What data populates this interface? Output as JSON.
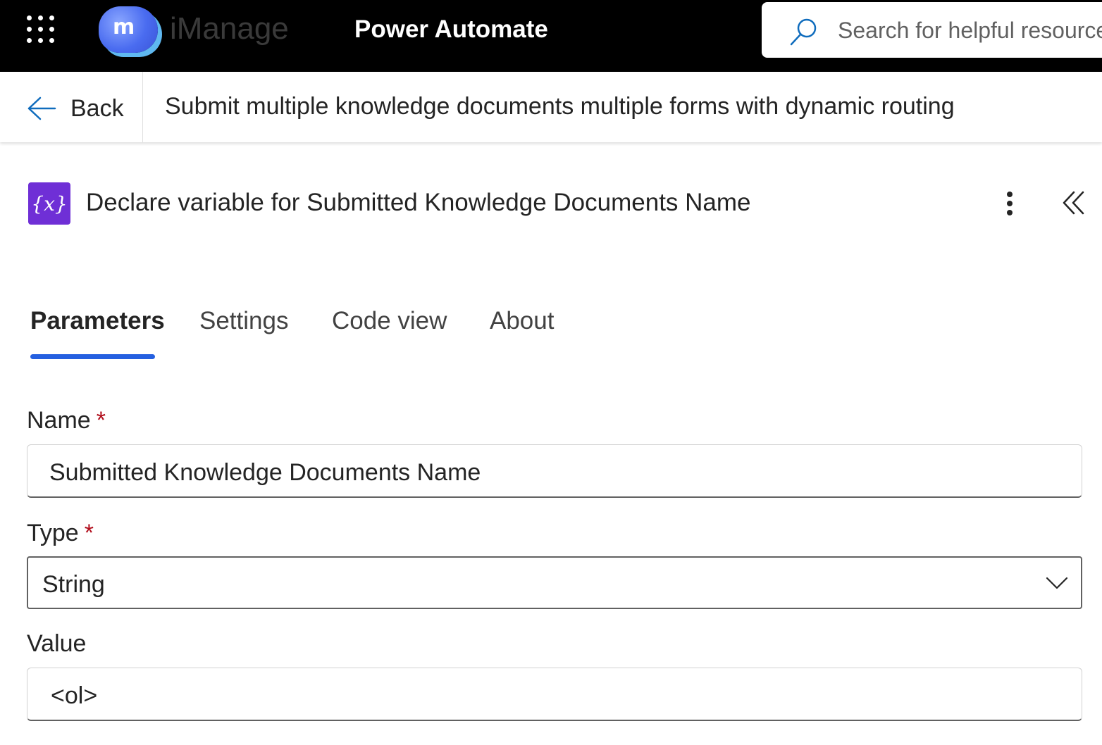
{
  "topbar": {
    "logo_mark": "m",
    "logo_text": "iManage",
    "app_title": "Power Automate",
    "search_placeholder": "Search for helpful resources"
  },
  "header": {
    "back_label": "Back",
    "flow_title": "Submit multiple knowledge documents multiple forms with dynamic routing"
  },
  "action": {
    "icon_text": "{x}",
    "title": "Declare variable for Submitted Knowledge Documents Name",
    "icon_color": "#6f2fd6"
  },
  "tabs": [
    {
      "label": "Parameters",
      "active": true
    },
    {
      "label": "Settings",
      "active": false
    },
    {
      "label": "Code view",
      "active": false
    },
    {
      "label": "About",
      "active": false
    }
  ],
  "form": {
    "name_label": "Name",
    "name_value": "Submitted Knowledge Documents Name",
    "type_label": "Type",
    "type_value": "String",
    "value_label": "Value",
    "value_value": "<ol>",
    "required_marker": "*"
  },
  "colors": {
    "topbar_bg": "#000000",
    "accent": "#2560e0",
    "required": "#b10e1c"
  },
  "icons": [
    "waffle-icon",
    "search-icon",
    "back-arrow-icon",
    "more-vertical-icon",
    "collapse-double-chevron-icon",
    "chevron-down-icon",
    "variable-icon"
  ]
}
